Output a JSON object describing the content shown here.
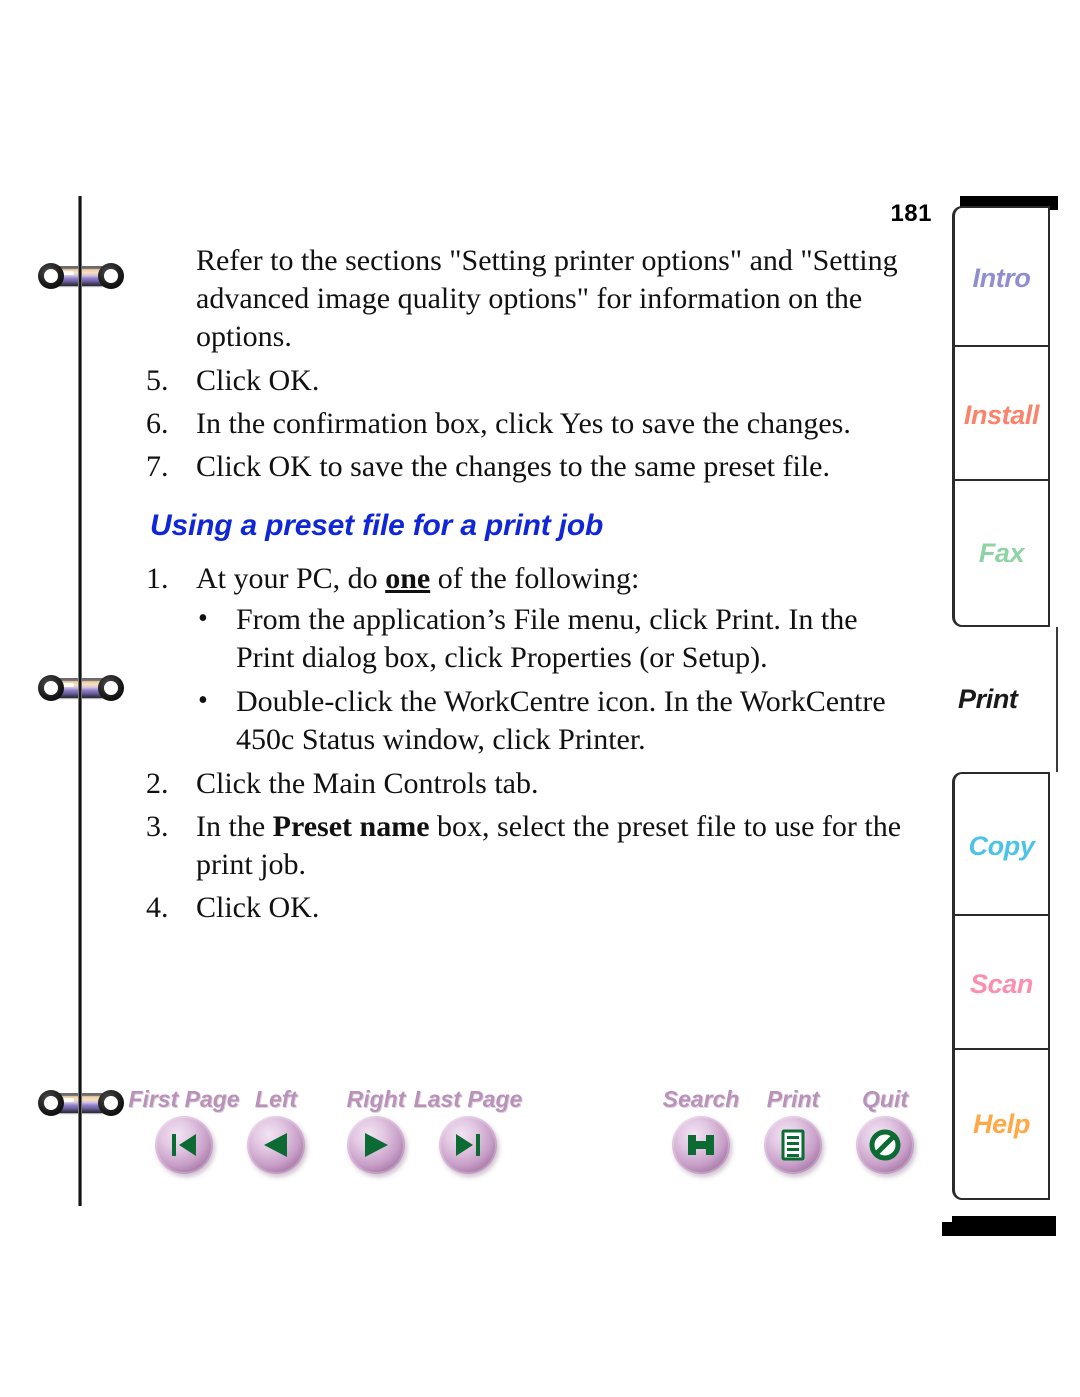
{
  "page": {
    "number": "181",
    "accent_heading_color": "#1027d8",
    "button_color": "#c79ec7",
    "glyph_color": "#0b6b33"
  },
  "content": {
    "intro_paragraph": "Refer to the sections \"Setting printer options\" and \"Setting advanced image quality options\" for information on the options.",
    "steps_continued": [
      {
        "num": "5.",
        "text": "Click OK."
      },
      {
        "num": "6.",
        "text": "In the confirmation box, click Yes to save the changes."
      },
      {
        "num": "7.",
        "text": "Click OK to save the changes to the same preset file."
      }
    ],
    "heading": "Using a preset file for a print job",
    "steps": [
      {
        "num": "1.",
        "text_before": "At your PC, do ",
        "emphasis": "one",
        "text_after": " of the following:"
      },
      {
        "num": "2.",
        "text": "Click the Main Controls tab."
      },
      {
        "num": "3.",
        "text_before": "In the ",
        "emphasis": "Preset name",
        "text_after": " box, select the preset file to use for the print job."
      },
      {
        "num": "4.",
        "text": "Click OK."
      }
    ],
    "bullets": [
      "From the application’s File menu, click Print. In the Print dialog box, click Properties (or Setup).",
      "Double-click the WorkCentre icon. In the WorkCentre 450c Status window, click Printer."
    ],
    "bullet_marker": "•"
  },
  "tabs": [
    {
      "label": "Intro",
      "color": "#8f8fd0",
      "current": false
    },
    {
      "label": "Install",
      "color": "#f9836b",
      "current": false
    },
    {
      "label": "Fax",
      "color": "#8ed3a3",
      "current": false
    },
    {
      "label": "Print",
      "color": "#1a1a1a",
      "current": true
    },
    {
      "label": "Copy",
      "color": "#4ec3e8",
      "current": false
    },
    {
      "label": "Scan",
      "color": "#fb8fae",
      "current": false
    },
    {
      "label": "Help",
      "color": "#ffa845",
      "current": false
    }
  ],
  "toolbar": {
    "nav": [
      {
        "label": "First Page",
        "icon": "first-page-icon"
      },
      {
        "label": "Left",
        "icon": "previous-page-icon"
      },
      {
        "label": "Right",
        "icon": "next-page-icon"
      },
      {
        "label": "Last Page",
        "icon": "last-page-icon"
      }
    ],
    "actions": [
      {
        "label": "Search",
        "icon": "search-icon"
      },
      {
        "label": "Print",
        "icon": "print-document-icon"
      },
      {
        "label": "Quit",
        "icon": "quit-no-entry-icon"
      }
    ]
  }
}
